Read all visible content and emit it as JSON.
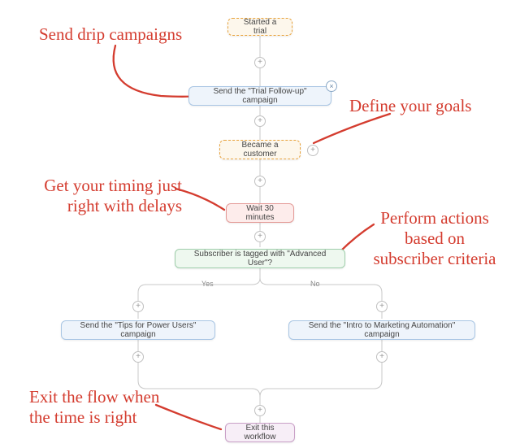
{
  "nodes": {
    "n1": "Started a trial",
    "n2": "Send the \"Trial Follow-up\" campaign",
    "n3": "Became a customer",
    "n4": "Wait 30 minutes",
    "n5": "Subscriber is tagged with \"Advanced User\"?",
    "n6": "Send the \"Tips for Power Users\" campaign",
    "n7": "Send the \"Intro to Marketing Automation\" campaign",
    "n8": "Exit this workflow"
  },
  "branches": {
    "yes": "Yes",
    "no": "No"
  },
  "annotations": {
    "a1": "Send drip campaigns",
    "a2": "Define your goals",
    "a3": "Get your timing just\nright with delays",
    "a4": "Perform actions\nbased on\nsubscriber criteria",
    "a5": "Exit the flow when\nthe time is right"
  },
  "glyphs": {
    "plus": "+",
    "close": "×"
  },
  "colors": {
    "anno": "#d43c2f"
  }
}
